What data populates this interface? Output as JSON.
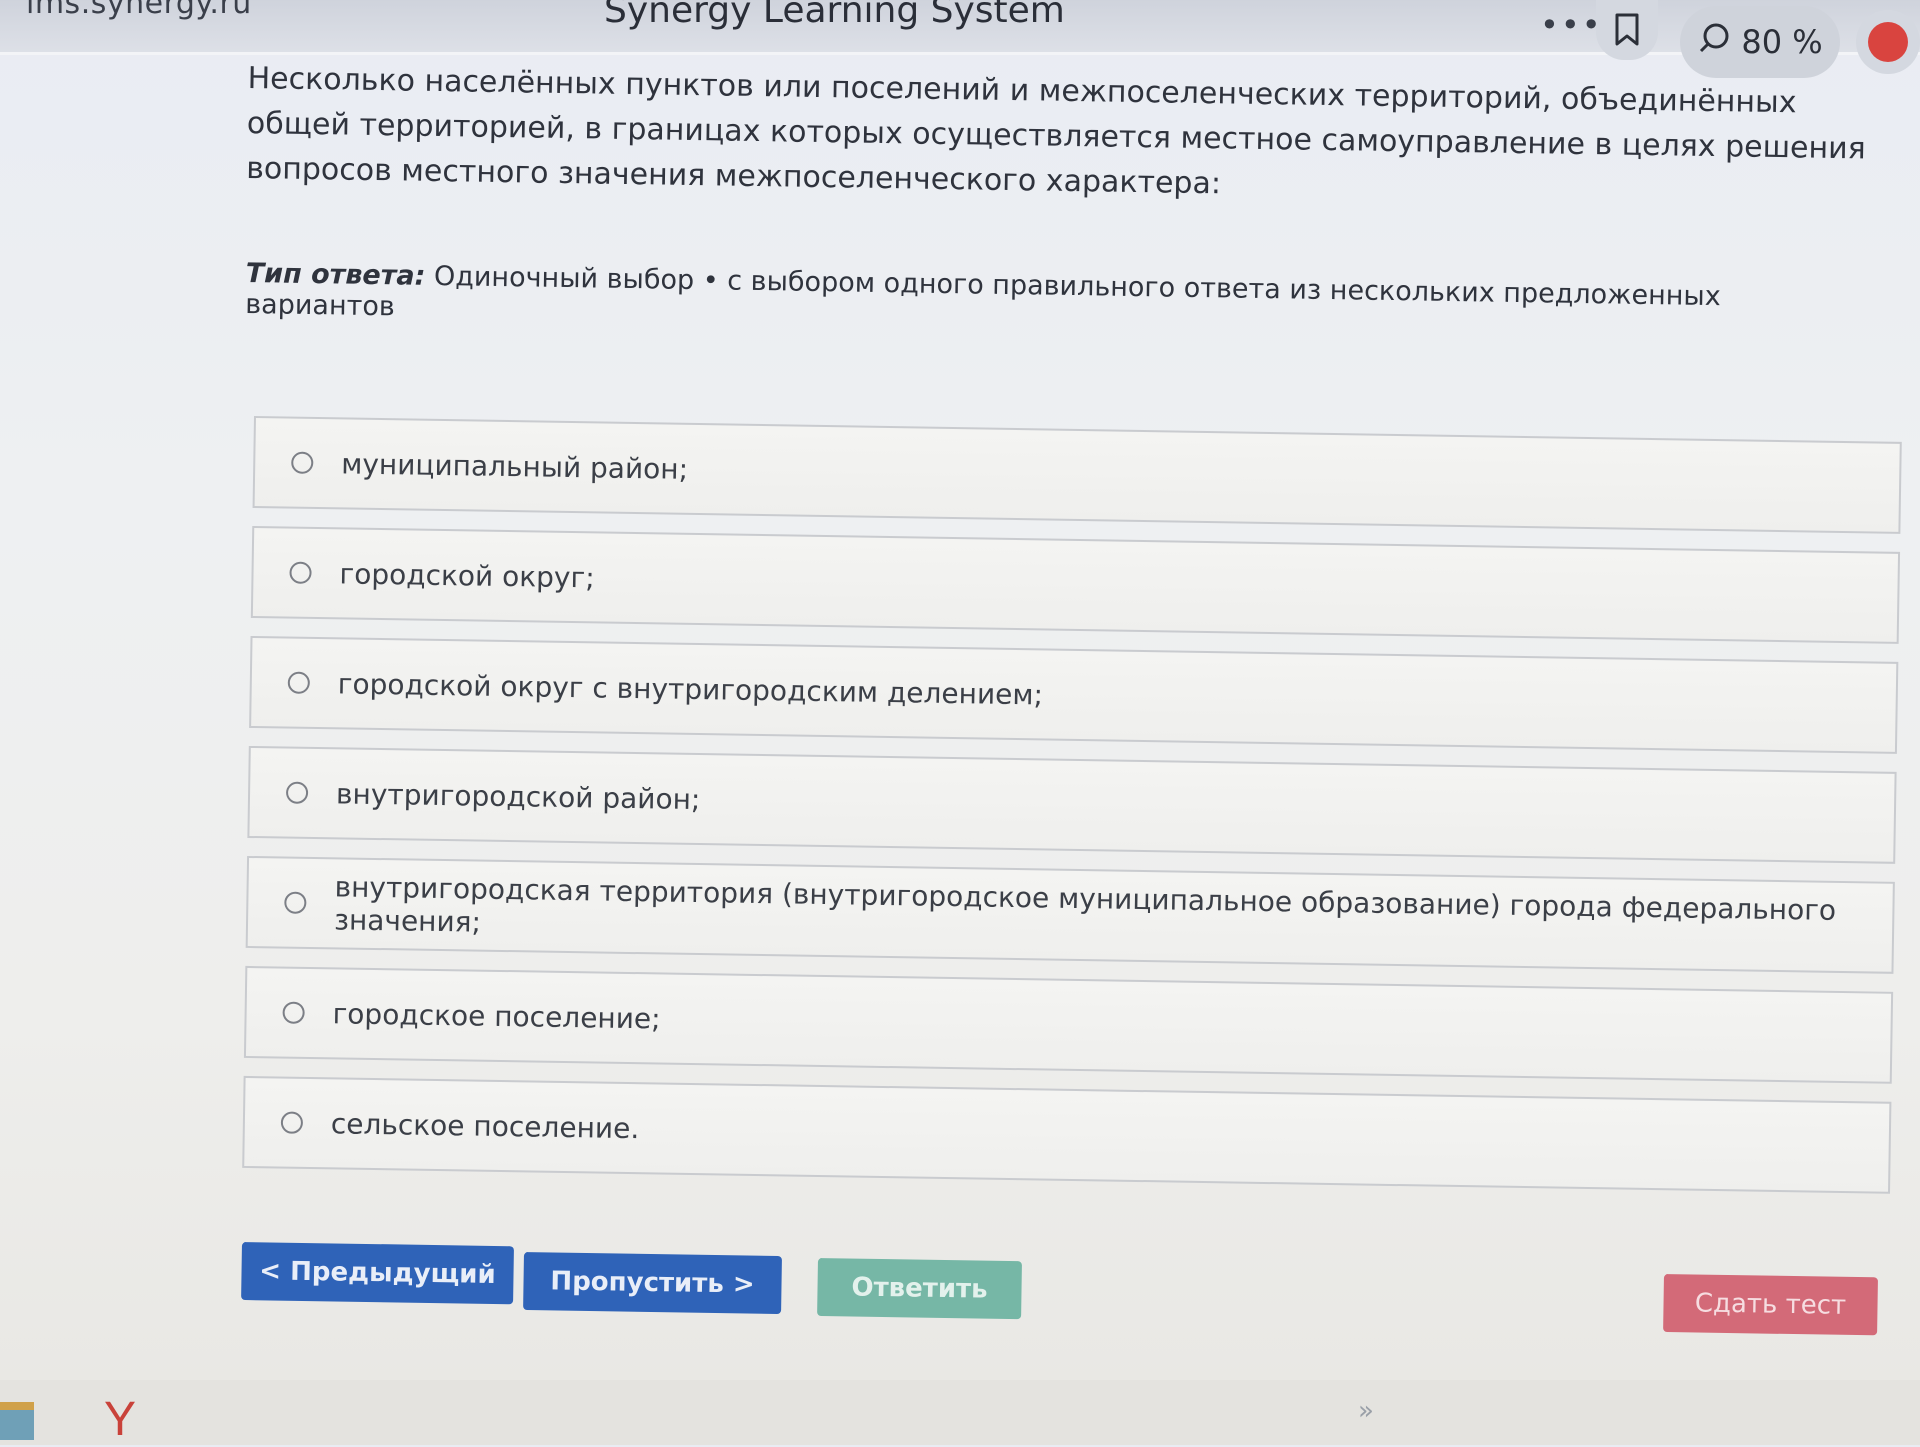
{
  "browser": {
    "url": "lms.synergy.ru",
    "title": "Synergy Learning System",
    "more_icon": "more-icon",
    "bookmark_icon": "bookmark-icon",
    "zoom": "80 %",
    "zoom_icon": "chat-icon",
    "record_icon": "record-icon"
  },
  "question": {
    "text": "Несколько населённых пунктов или поселений и межпоселенческих территорий, объединённых общей территорией, в границах которых осуществляется местное самоуправление в целях решения вопросов местного значения межпоселенческого характера:",
    "answer_type_label": "Тип ответа:",
    "answer_type_value": "Одиночный выбор • с выбором одного правильного ответа из нескольких предложенных вариантов"
  },
  "options": [
    "муниципальный район;",
    "городской округ;",
    "городской округ с внутригородским делением;",
    "внутригородской район;",
    "внутригородская территория (внутригородское муниципальное образование) города федерального значения;",
    "городское поселение;",
    "сельское поселение."
  ],
  "buttons": {
    "prev": "< Предыдущий",
    "skip": "Пропустить >",
    "answer": "Ответить",
    "submit": "Сдать тест"
  },
  "taskbar": {
    "icons": [
      "file-manager-icon",
      "yandex-browser-icon",
      "chevron-right-icon"
    ]
  }
}
